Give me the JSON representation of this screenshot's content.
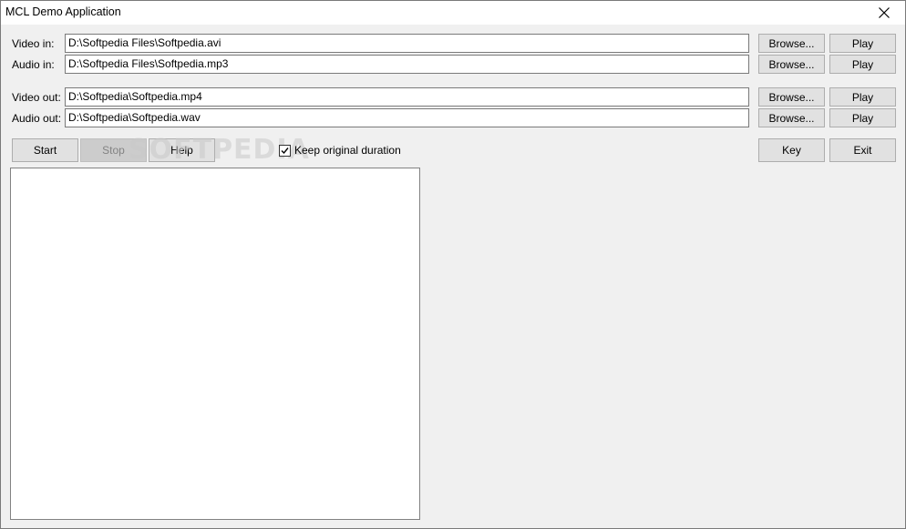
{
  "window": {
    "title": "MCL Demo Application"
  },
  "inputs": {
    "video_in": {
      "label": "Video in:",
      "value": "D:\\Softpedia Files\\Softpedia.avi"
    },
    "audio_in": {
      "label": "Audio in:",
      "value": "D:\\Softpedia Files\\Softpedia.mp3"
    },
    "video_out": {
      "label": "Video out:",
      "value": "D:\\Softpedia\\Softpedia.mp4"
    },
    "audio_out": {
      "label": "Audio out:",
      "value": "D:\\Softpedia\\Softpedia.wav"
    }
  },
  "buttons": {
    "browse": "Browse...",
    "play": "Play",
    "start": "Start",
    "stop": "Stop",
    "help": "Help",
    "key": "Key",
    "exit": "Exit"
  },
  "options": {
    "keep_original_duration": {
      "label": "Keep original duration",
      "checked": true
    }
  },
  "watermark": "SOFTPEDIA",
  "icons": {
    "close": "close-icon",
    "check": "checkmark-icon"
  }
}
